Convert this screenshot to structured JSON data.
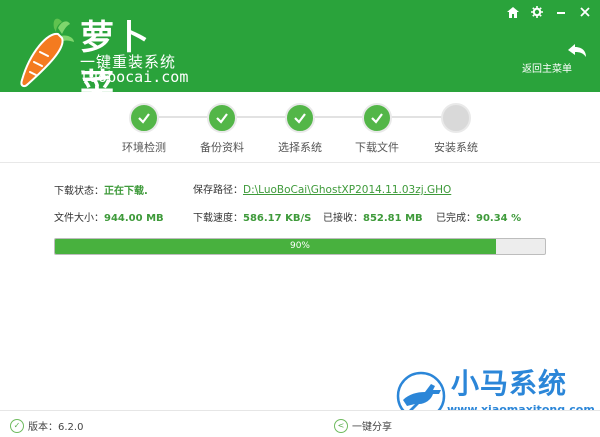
{
  "header": {
    "brand_title": "萝卜菜",
    "brand_slogan": "一键重装系统",
    "brand_url": "luobocai.com",
    "back_label": "返回主菜单",
    "window_controls": [
      "home-icon",
      "gear-icon",
      "minimize-icon",
      "close-icon"
    ]
  },
  "steps": [
    {
      "label": "环境检测",
      "status": "done"
    },
    {
      "label": "备份资料",
      "status": "done"
    },
    {
      "label": "选择系统",
      "status": "done"
    },
    {
      "label": "下载文件",
      "status": "done"
    },
    {
      "label": "安装系统",
      "status": "pending"
    }
  ],
  "download": {
    "status_label": "下载状态：",
    "status_value": "正在下载.",
    "path_label": "保存路径：",
    "path_value": "D:\\LuoBoCai\\GhostXP2014.11.03zj.GHO",
    "size_label": "文件大小：",
    "size_value": "944.00 MB",
    "speed_label": "下载速度：",
    "speed_value": "586.17 KB/S",
    "received_label": "已接收：",
    "received_value": "852.81 MB",
    "completed_label": "已完成：",
    "completed_value": "90.34 %"
  },
  "progress": {
    "text": "90%",
    "fraction": 0.9
  },
  "footer": {
    "version_label": "版本：6.2.0",
    "share_label": "一键分享"
  },
  "watermark": {
    "text": "小马系统",
    "url": "www.xiaomaxitong.com"
  },
  "colors": {
    "brand_green": "#2aa33b",
    "progress_green": "#48b13e",
    "watermark_blue": "#2b86d8"
  }
}
